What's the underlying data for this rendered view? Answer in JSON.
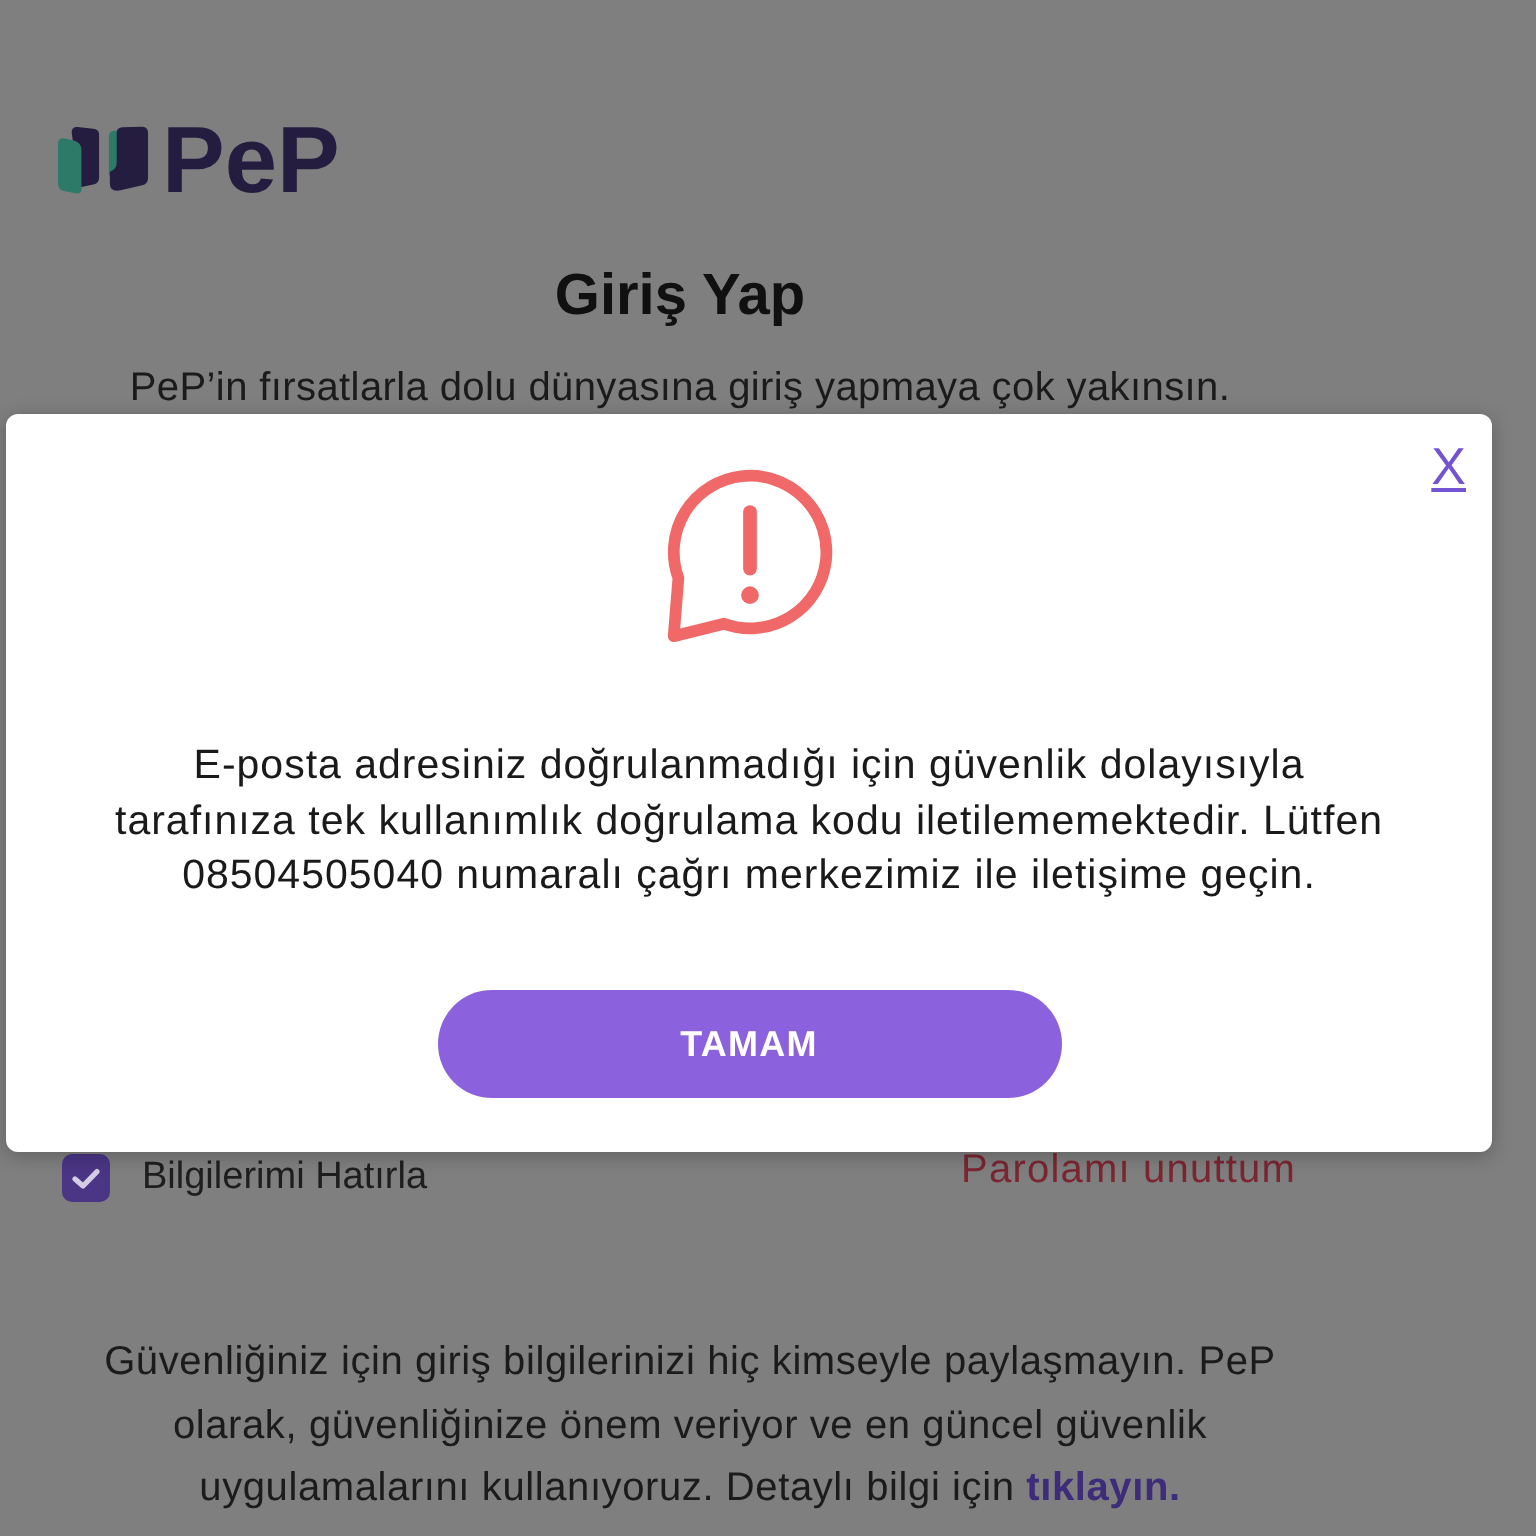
{
  "logo": {
    "text": "PeP"
  },
  "page": {
    "title": "Giriş Yap",
    "subtitle": "PeP’in fırsatlarla dolu dünyasına giriş yapmaya çok yakınsın.",
    "remember_me": {
      "label": "Bilgilerimi Hatırla",
      "checked": true
    },
    "forgot_password": "Parolamı unuttum",
    "security_note": {
      "text": "Güvenliğiniz için giriş bilgilerinizi hiç kimseyle paylaşmayın. PeP\nolarak, güvenliğinize önem veriyor ve en güncel güvenlik\nuygulamalarını kullanıyoruz. Detaylı bilgi için",
      "link": "tıklayın."
    }
  },
  "dialog": {
    "close": "X",
    "message": "E-posta adresiniz doğrulanmadığı için güvenlik dolayısıyla\ntarafınıza tek kullanımlık doğrulama kodu iletilememektedir. Lütfen\n08504505040 numaralı çağrı merkezimiz ile iletişime geçin.",
    "button": "TAMAM"
  }
}
